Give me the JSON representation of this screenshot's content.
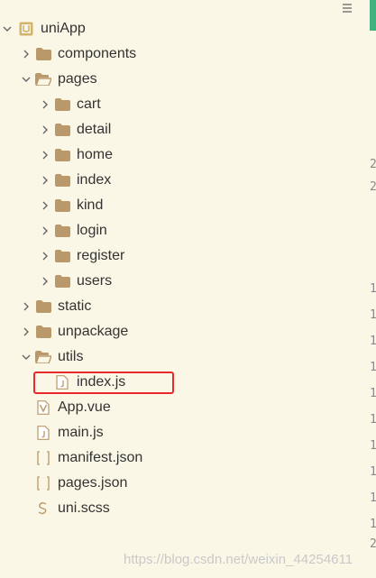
{
  "project": {
    "root": "uniApp",
    "items": [
      {
        "label": "components",
        "type": "folder",
        "level": 1,
        "expanded": false,
        "name": "tree-item-components"
      },
      {
        "label": "pages",
        "type": "folder-open",
        "level": 1,
        "expanded": true,
        "name": "tree-item-pages"
      },
      {
        "label": "cart",
        "type": "folder",
        "level": 2,
        "expanded": false,
        "name": "tree-item-cart"
      },
      {
        "label": "detail",
        "type": "folder",
        "level": 2,
        "expanded": false,
        "name": "tree-item-detail"
      },
      {
        "label": "home",
        "type": "folder",
        "level": 2,
        "expanded": false,
        "name": "tree-item-home"
      },
      {
        "label": "index",
        "type": "folder",
        "level": 2,
        "expanded": false,
        "name": "tree-item-index"
      },
      {
        "label": "kind",
        "type": "folder",
        "level": 2,
        "expanded": false,
        "name": "tree-item-kind"
      },
      {
        "label": "login",
        "type": "folder",
        "level": 2,
        "expanded": false,
        "name": "tree-item-login"
      },
      {
        "label": "register",
        "type": "folder",
        "level": 2,
        "expanded": false,
        "name": "tree-item-register"
      },
      {
        "label": "users",
        "type": "folder",
        "level": 2,
        "expanded": false,
        "name": "tree-item-users"
      },
      {
        "label": "static",
        "type": "folder",
        "level": 1,
        "expanded": false,
        "name": "tree-item-static"
      },
      {
        "label": "unpackage",
        "type": "folder",
        "level": 1,
        "expanded": false,
        "name": "tree-item-unpackage"
      },
      {
        "label": "utils",
        "type": "folder-open",
        "level": 1,
        "expanded": true,
        "name": "tree-item-utils"
      },
      {
        "label": "index.js",
        "type": "file-js",
        "level": 2,
        "name": "tree-item-index-js"
      },
      {
        "label": "App.vue",
        "type": "file-vue",
        "level": 1,
        "name": "tree-item-app-vue"
      },
      {
        "label": "main.js",
        "type": "file-js",
        "level": 1,
        "name": "tree-item-main-js"
      },
      {
        "label": "manifest.json",
        "type": "file-json",
        "level": 1,
        "name": "tree-item-manifest-json"
      },
      {
        "label": "pages.json",
        "type": "file-json",
        "level": 1,
        "name": "tree-item-pages-json"
      },
      {
        "label": "uni.scss",
        "type": "file-scss",
        "level": 1,
        "name": "tree-item-uni-scss"
      }
    ]
  },
  "gutter": [
    "2",
    "2",
    "1",
    "1",
    "1",
    "1",
    "1",
    "1",
    "1",
    "1",
    "1",
    "1",
    "2"
  ],
  "watermark": "https://blog.csdn.net/weixin_44254611",
  "colors": {
    "background": "#fbf7e6",
    "folder": "#b9996a",
    "chevron": "#666666",
    "highlight": "#e8282b",
    "root_icon": "#d4b36b"
  },
  "icons": {
    "root": "project-icon",
    "folder": "folder-icon",
    "folder_open": "folder-open-icon",
    "js": "js-file-icon",
    "vue": "vue-file-icon",
    "json": "json-file-icon",
    "scss": "scss-file-icon",
    "menu": "menu-icon"
  }
}
